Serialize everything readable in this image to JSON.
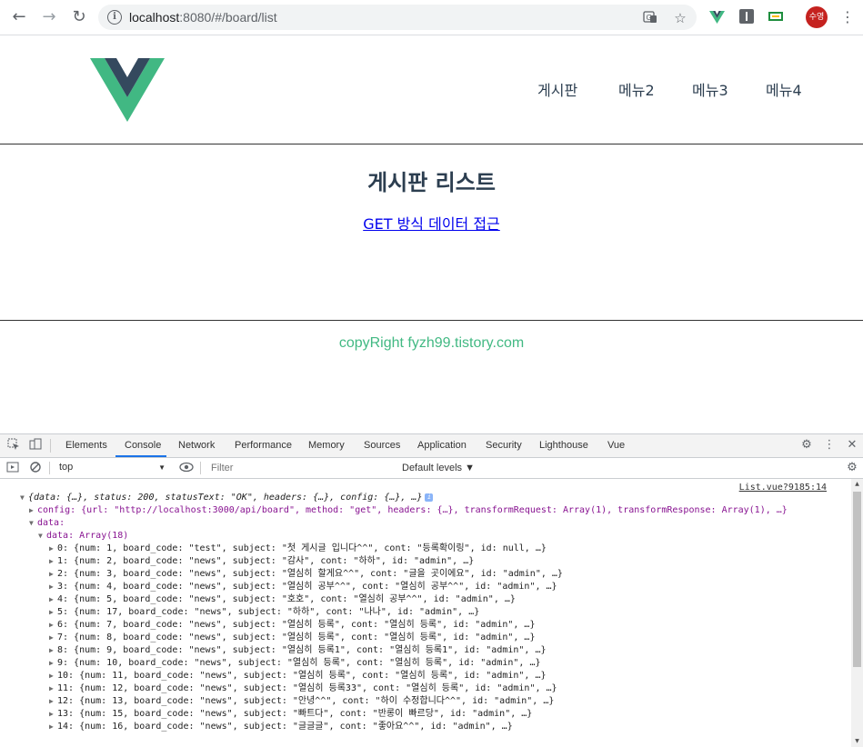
{
  "browser": {
    "url_host": "localhost",
    "url_rest": ":8080/#/board/list",
    "avatar_text": "수영"
  },
  "header": {
    "nav": [
      "게시판",
      "메뉴2",
      "메뉴3",
      "메뉴4"
    ]
  },
  "main": {
    "title": "게시판 리스트",
    "link_text": "GET 방식 데이터 접근"
  },
  "footer": {
    "text": "copyRight fyzh99.tistory.com"
  },
  "colors": {
    "vue_green": "#41b883",
    "vue_dark": "#34495e",
    "footer": "#42b983"
  },
  "devtools": {
    "tabs": [
      "Elements",
      "Console",
      "Network",
      "Performance",
      "Memory",
      "Sources",
      "Application",
      "Security",
      "Lighthouse",
      "Vue"
    ],
    "active_tab": "Console",
    "context": "top",
    "filter_placeholder": "Filter",
    "levels": "Default levels ▼",
    "source_link": "List.vue?9185:14",
    "lines": [
      "{data: {…}, status: 200, statusText: \"OK\", headers: {…}, config: {…}, …}",
      "config: {url: \"http://localhost:3000/api/board\", method: \"get\", headers: {…}, transformRequest: Array(1), transformResponse: Array(1), …}",
      "data:",
      "data: Array(18)",
      "0: {num: 1, board_code: \"test\", subject: \"첫 게시글 입니다^^\", cont: \"등록확이링\", id: null, …}",
      "1: {num: 2, board_code: \"news\", subject: \"감사\", cont: \"하하\", id: \"admin\", …}",
      "2: {num: 3, board_code: \"news\", subject: \"열심히 할게요^^\", cont: \"글을 곳이에요\", id: \"admin\", …}",
      "3: {num: 4, board_code: \"news\", subject: \"열심히 공부^^\", cont: \"열심히 공부^^\", id: \"admin\", …}",
      "4: {num: 5, board_code: \"news\", subject: \"호호\", cont: \"열심히 공부^^\", id: \"admin\", …}",
      "5: {num: 17, board_code: \"news\", subject: \"하하\", cont: \"나나\", id: \"admin\", …}",
      "6: {num: 7, board_code: \"news\", subject: \"열심히 등록\", cont: \"열심히 등록\", id: \"admin\", …}",
      "7: {num: 8, board_code: \"news\", subject: \"열심히 등록\", cont: \"열심히 등록\", id: \"admin\", …}",
      "8: {num: 9, board_code: \"news\", subject: \"열심히 등록1\", cont: \"열심히 등록1\", id: \"admin\", …}",
      "9: {num: 10, board_code: \"news\", subject: \"열심히 등록\", cont: \"열심히 등록\", id: \"admin\", …}",
      "10: {num: 11, board_code: \"news\", subject: \"열심히 등록\", cont: \"열심히 등록\", id: \"admin\", …}",
      "11: {num: 12, board_code: \"news\", subject: \"열심히 등록33\", cont: \"열심히 등록\", id: \"admin\", …}",
      "12: {num: 13, board_code: \"news\", subject: \"안녕^^\", cont: \"하이 수정합니다^^\", id: \"admin\", …}",
      "13: {num: 15, board_code: \"news\", subject: \"빠트다\", cont: \"반롱이 빠르당\", id: \"admin\", …}",
      "14: {num: 16, board_code: \"news\", subject: \"글글글\", cont: \"좋아요^^\", id: \"admin\", …}"
    ]
  }
}
